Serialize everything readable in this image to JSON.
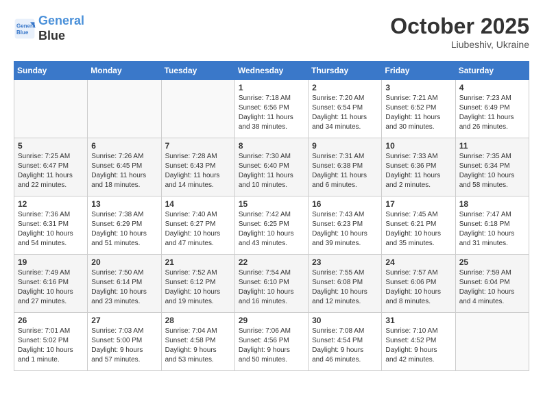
{
  "logo": {
    "line1": "General",
    "line2": "Blue"
  },
  "title": "October 2025",
  "subtitle": "Liubeshiv, Ukraine",
  "days_header": [
    "Sunday",
    "Monday",
    "Tuesday",
    "Wednesday",
    "Thursday",
    "Friday",
    "Saturday"
  ],
  "weeks": [
    [
      {
        "day": "",
        "info": ""
      },
      {
        "day": "",
        "info": ""
      },
      {
        "day": "",
        "info": ""
      },
      {
        "day": "1",
        "info": "Sunrise: 7:18 AM\nSunset: 6:56 PM\nDaylight: 11 hours\nand 38 minutes."
      },
      {
        "day": "2",
        "info": "Sunrise: 7:20 AM\nSunset: 6:54 PM\nDaylight: 11 hours\nand 34 minutes."
      },
      {
        "day": "3",
        "info": "Sunrise: 7:21 AM\nSunset: 6:52 PM\nDaylight: 11 hours\nand 30 minutes."
      },
      {
        "day": "4",
        "info": "Sunrise: 7:23 AM\nSunset: 6:49 PM\nDaylight: 11 hours\nand 26 minutes."
      }
    ],
    [
      {
        "day": "5",
        "info": "Sunrise: 7:25 AM\nSunset: 6:47 PM\nDaylight: 11 hours\nand 22 minutes."
      },
      {
        "day": "6",
        "info": "Sunrise: 7:26 AM\nSunset: 6:45 PM\nDaylight: 11 hours\nand 18 minutes."
      },
      {
        "day": "7",
        "info": "Sunrise: 7:28 AM\nSunset: 6:43 PM\nDaylight: 11 hours\nand 14 minutes."
      },
      {
        "day": "8",
        "info": "Sunrise: 7:30 AM\nSunset: 6:40 PM\nDaylight: 11 hours\nand 10 minutes."
      },
      {
        "day": "9",
        "info": "Sunrise: 7:31 AM\nSunset: 6:38 PM\nDaylight: 11 hours\nand 6 minutes."
      },
      {
        "day": "10",
        "info": "Sunrise: 7:33 AM\nSunset: 6:36 PM\nDaylight: 11 hours\nand 2 minutes."
      },
      {
        "day": "11",
        "info": "Sunrise: 7:35 AM\nSunset: 6:34 PM\nDaylight: 10 hours\nand 58 minutes."
      }
    ],
    [
      {
        "day": "12",
        "info": "Sunrise: 7:36 AM\nSunset: 6:31 PM\nDaylight: 10 hours\nand 54 minutes."
      },
      {
        "day": "13",
        "info": "Sunrise: 7:38 AM\nSunset: 6:29 PM\nDaylight: 10 hours\nand 51 minutes."
      },
      {
        "day": "14",
        "info": "Sunrise: 7:40 AM\nSunset: 6:27 PM\nDaylight: 10 hours\nand 47 minutes."
      },
      {
        "day": "15",
        "info": "Sunrise: 7:42 AM\nSunset: 6:25 PM\nDaylight: 10 hours\nand 43 minutes."
      },
      {
        "day": "16",
        "info": "Sunrise: 7:43 AM\nSunset: 6:23 PM\nDaylight: 10 hours\nand 39 minutes."
      },
      {
        "day": "17",
        "info": "Sunrise: 7:45 AM\nSunset: 6:21 PM\nDaylight: 10 hours\nand 35 minutes."
      },
      {
        "day": "18",
        "info": "Sunrise: 7:47 AM\nSunset: 6:18 PM\nDaylight: 10 hours\nand 31 minutes."
      }
    ],
    [
      {
        "day": "19",
        "info": "Sunrise: 7:49 AM\nSunset: 6:16 PM\nDaylight: 10 hours\nand 27 minutes."
      },
      {
        "day": "20",
        "info": "Sunrise: 7:50 AM\nSunset: 6:14 PM\nDaylight: 10 hours\nand 23 minutes."
      },
      {
        "day": "21",
        "info": "Sunrise: 7:52 AM\nSunset: 6:12 PM\nDaylight: 10 hours\nand 19 minutes."
      },
      {
        "day": "22",
        "info": "Sunrise: 7:54 AM\nSunset: 6:10 PM\nDaylight: 10 hours\nand 16 minutes."
      },
      {
        "day": "23",
        "info": "Sunrise: 7:55 AM\nSunset: 6:08 PM\nDaylight: 10 hours\nand 12 minutes."
      },
      {
        "day": "24",
        "info": "Sunrise: 7:57 AM\nSunset: 6:06 PM\nDaylight: 10 hours\nand 8 minutes."
      },
      {
        "day": "25",
        "info": "Sunrise: 7:59 AM\nSunset: 6:04 PM\nDaylight: 10 hours\nand 4 minutes."
      }
    ],
    [
      {
        "day": "26",
        "info": "Sunrise: 7:01 AM\nSunset: 5:02 PM\nDaylight: 10 hours\nand 1 minute."
      },
      {
        "day": "27",
        "info": "Sunrise: 7:03 AM\nSunset: 5:00 PM\nDaylight: 9 hours\nand 57 minutes."
      },
      {
        "day": "28",
        "info": "Sunrise: 7:04 AM\nSunset: 4:58 PM\nDaylight: 9 hours\nand 53 minutes."
      },
      {
        "day": "29",
        "info": "Sunrise: 7:06 AM\nSunset: 4:56 PM\nDaylight: 9 hours\nand 50 minutes."
      },
      {
        "day": "30",
        "info": "Sunrise: 7:08 AM\nSunset: 4:54 PM\nDaylight: 9 hours\nand 46 minutes."
      },
      {
        "day": "31",
        "info": "Sunrise: 7:10 AM\nSunset: 4:52 PM\nDaylight: 9 hours\nand 42 minutes."
      },
      {
        "day": "",
        "info": ""
      }
    ]
  ]
}
